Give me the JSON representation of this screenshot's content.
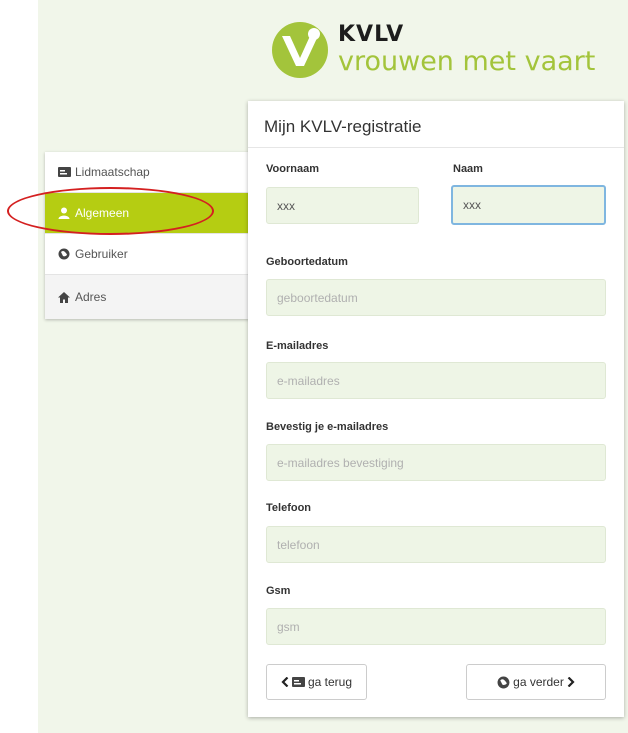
{
  "logo": {
    "brand": "KVLV",
    "tagline": "vrouwen met vaart",
    "accent_color": "#a3c43b"
  },
  "sidenav": {
    "items": [
      {
        "label": "Lidmaatschap",
        "icon": "id-card-icon",
        "active": false
      },
      {
        "label": "Algemeen",
        "icon": "user-icon",
        "active": true
      },
      {
        "label": "Gebruiker",
        "icon": "globe-icon",
        "active": false
      },
      {
        "label": "Adres",
        "icon": "home-icon",
        "active": false
      }
    ],
    "active_color": "#b5cd12"
  },
  "form": {
    "title": "Mijn KVLV-registratie",
    "voornaam": {
      "label": "Voornaam",
      "value": "xxx"
    },
    "naam": {
      "label": "Naam",
      "value": "xxx"
    },
    "geboortedatum": {
      "label": "Geboortedatum",
      "placeholder": "geboortedatum"
    },
    "email": {
      "label": "E-mailadres",
      "placeholder": "e-mailadres"
    },
    "email_confirm": {
      "label": "Bevestig je e-mailadres",
      "placeholder": "e-mailadres bevestiging"
    },
    "telefoon": {
      "label": "Telefoon",
      "placeholder": "telefoon"
    },
    "gsm": {
      "label": "Gsm",
      "placeholder": "gsm"
    }
  },
  "buttons": {
    "back": "ga terug",
    "next": "ga verder"
  },
  "annotation_color": "#d42020"
}
